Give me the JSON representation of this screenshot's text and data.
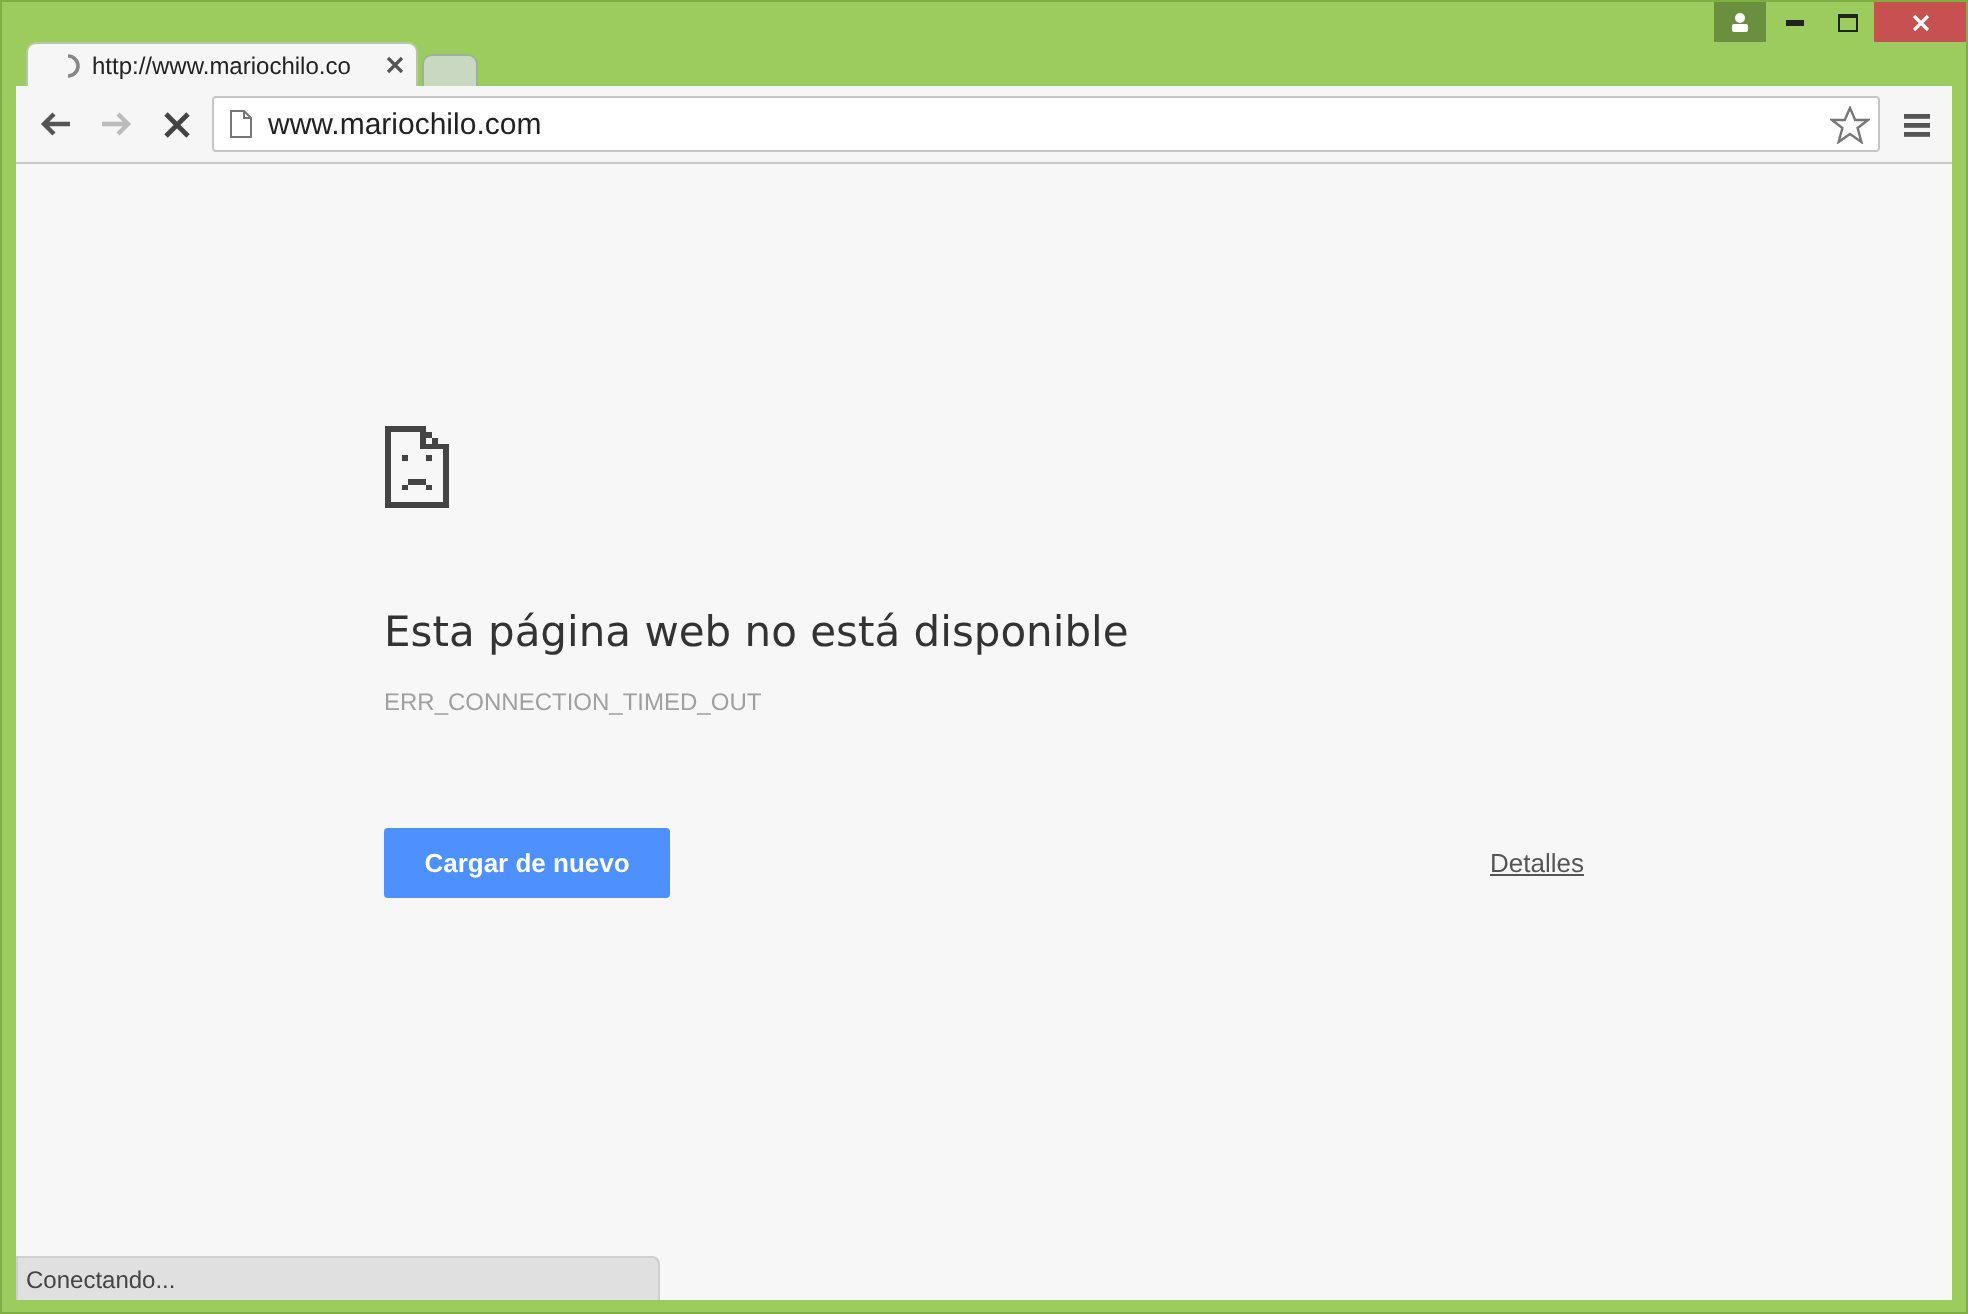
{
  "tabs": [
    {
      "title": "http://www.mariochilo.co",
      "loading": true,
      "selected": true
    },
    {
      "selected": false
    }
  ],
  "toolbar": {
    "back_disabled": false,
    "forward_disabled": true,
    "url": "www.mariochilo.com"
  },
  "error": {
    "heading": "Esta página web no está disponible",
    "code": "ERR_CONNECTION_TIMED_OUT",
    "reload_button": "Cargar de nuevo",
    "details_link": "Detalles"
  },
  "status_bar": "Conectando..."
}
